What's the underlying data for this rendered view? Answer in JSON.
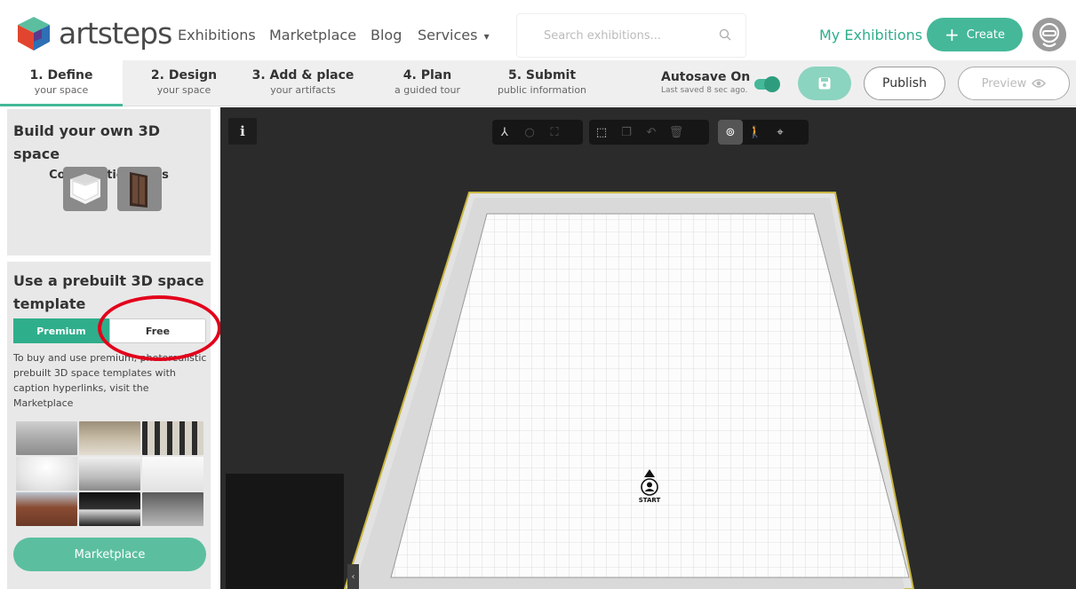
{
  "brand": {
    "name": "artsteps"
  },
  "nav": {
    "exhibitions": "Exhibitions",
    "marketplace": "Marketplace",
    "blog": "Blog",
    "services": "Services",
    "services_caret": "▾",
    "search_placeholder": "Search exhibitions...",
    "my_exhibitions": "My Exhibitions",
    "create_plus": "+",
    "create": "Create"
  },
  "steps": [
    {
      "title": "1. Define",
      "sub": "your space"
    },
    {
      "title": "2. Design",
      "sub": "your space"
    },
    {
      "title": "3. Add & place",
      "sub": "your artifacts"
    },
    {
      "title": "4. Plan",
      "sub": "a guided tour"
    },
    {
      "title": "5. Submit",
      "sub": "public information"
    }
  ],
  "autosave": {
    "label": "Autosave On",
    "last_saved": "Last saved 8 sec ago.",
    "enabled": true
  },
  "buttons": {
    "publish": "Publish",
    "preview": "Preview"
  },
  "build_panel": {
    "title": "Build your own 3D space",
    "tools_label": "Construction tools"
  },
  "template_panel": {
    "title_line1": "Use a prebuilt 3D space",
    "title_line2": "template",
    "tab_premium": "Premium",
    "tab_free": "Free",
    "description": "To buy and use premium, photorealistic prebuilt 3D space templates with caption hyperlinks, visit the Marketplace",
    "marketplace_button": "Marketplace"
  },
  "canvas": {
    "info": "i",
    "start_label": "START",
    "collapse": "‹"
  },
  "colors": {
    "accent": "#45b899",
    "highlight": "#e3001b",
    "canvas_bg": "#2b2b2b"
  }
}
